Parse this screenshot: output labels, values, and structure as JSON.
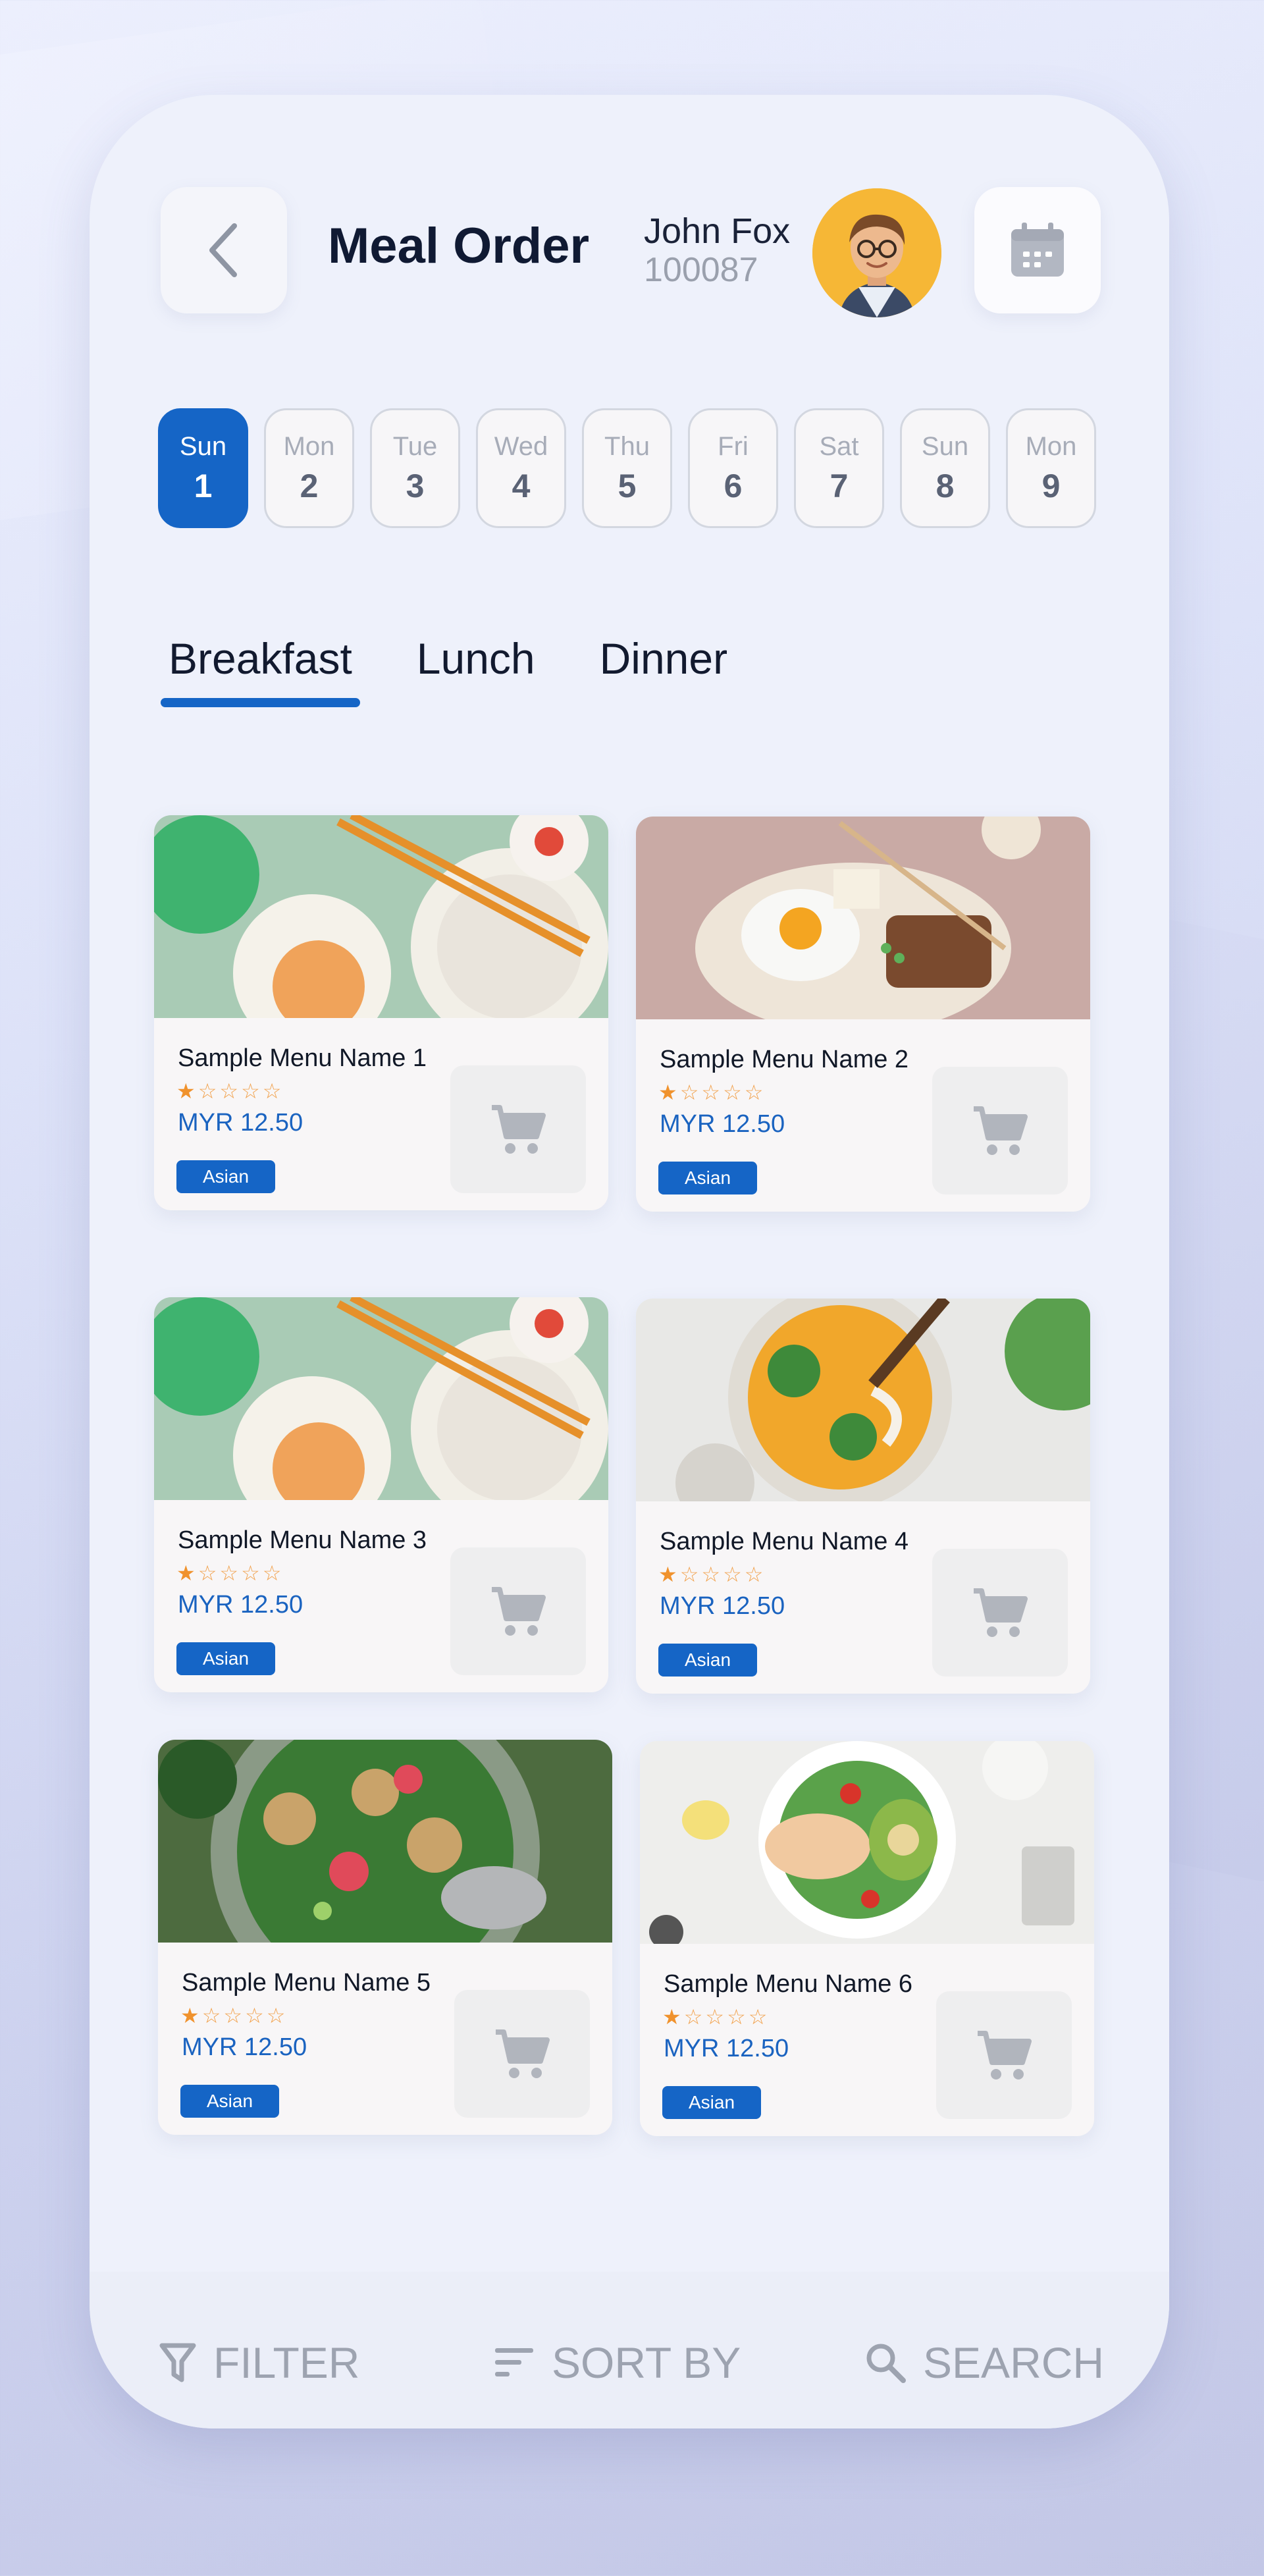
{
  "header": {
    "title": "Meal Order",
    "user_name": "John Fox",
    "user_id": "100087"
  },
  "days": [
    {
      "name": "Sun",
      "date": "1",
      "active": true
    },
    {
      "name": "Mon",
      "date": "2",
      "active": false
    },
    {
      "name": "Tue",
      "date": "3",
      "active": false
    },
    {
      "name": "Wed",
      "date": "4",
      "active": false
    },
    {
      "name": "Thu",
      "date": "5",
      "active": false
    },
    {
      "name": "Fri",
      "date": "6",
      "active": false
    },
    {
      "name": "Sat",
      "date": "7",
      "active": false
    },
    {
      "name": "Sun",
      "date": "8",
      "active": false
    },
    {
      "name": "Mon",
      "date": "9",
      "active": false
    }
  ],
  "tabs": [
    {
      "label": "Breakfast",
      "active": true
    },
    {
      "label": "Lunch",
      "active": false
    },
    {
      "label": "Dinner",
      "active": false
    }
  ],
  "menu_items": [
    {
      "name": "Sample Menu Name 1",
      "rating": 1,
      "max_rating": 5,
      "price": "MYR 12.50",
      "tag": "Asian"
    },
    {
      "name": "Sample Menu Name 2",
      "rating": 1,
      "max_rating": 5,
      "price": "MYR 12.50",
      "tag": "Asian"
    },
    {
      "name": "Sample Menu Name 3",
      "rating": 1,
      "max_rating": 5,
      "price": "MYR 12.50",
      "tag": "Asian"
    },
    {
      "name": "Sample Menu Name 4",
      "rating": 1,
      "max_rating": 5,
      "price": "MYR 12.50",
      "tag": "Asian"
    },
    {
      "name": "Sample Menu Name 5",
      "rating": 1,
      "max_rating": 5,
      "price": "MYR 12.50",
      "tag": "Asian"
    },
    {
      "name": "Sample Menu Name 6",
      "rating": 1,
      "max_rating": 5,
      "price": "MYR 12.50",
      "tag": "Asian"
    }
  ],
  "bottom_bar": {
    "filter_label": "FILTER",
    "sort_label": "SORT BY",
    "search_label": "SEARCH"
  },
  "icons": {
    "back": "chevron-left-icon",
    "calendar": "calendar-icon",
    "cart": "shopping-cart-icon",
    "filter": "filter-icon",
    "sort": "sort-icon",
    "search": "search-icon"
  },
  "colors": {
    "accent": "#1565c6",
    "star": "#f0922d",
    "price": "#1a63c0",
    "muted": "#9da3b0"
  }
}
